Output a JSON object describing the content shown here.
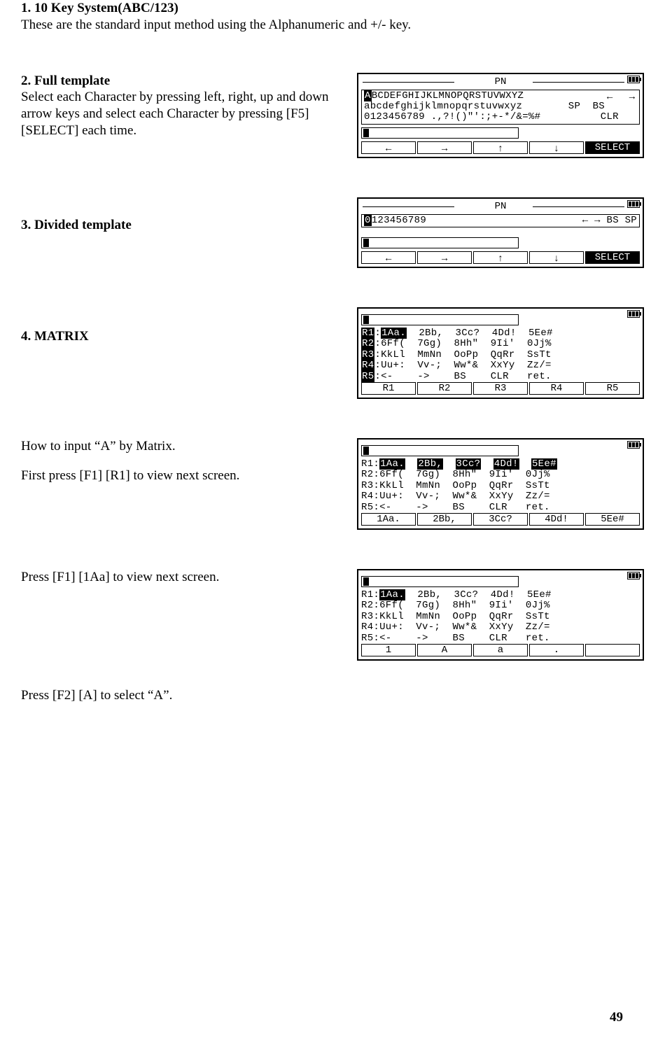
{
  "sections": {
    "s1": {
      "title": "1.  10 Key System(ABC/123)",
      "body": "These are the standard input method using the Alphanumeric and +/- key."
    },
    "s2": {
      "title": "2.  Full template",
      "body": "Select each Character by pressing left, right, up and down arrow keys and select each Character by pressing [F5] [SELECT] each time."
    },
    "s3": {
      "title": "3.  Divided template"
    },
    "s4": {
      "title": "4.  MATRIX"
    },
    "howto": {
      "line1": "How to input “A” by Matrix.",
      "line2": "First press [F1] [R1] to view next screen.",
      "line3": "Press [F1] [1Aa] to view next screen.",
      "line4": "Press [F2] [A] to select “A”."
    }
  },
  "pn_label": "PN",
  "char_rows": {
    "upper": "ABCDEFGHIJKLMNOPQRSTUVWXYZ",
    "lower": "abcdefghijklmnopqrstuvwxyz",
    "nums": "0123456789 .,?!()\"':;+-*/&=%#"
  },
  "right_labels": {
    "sp": "SP",
    "bs": "BS",
    "clr": "CLR",
    "select": "SELECT"
  },
  "arrows": {
    "left": "←",
    "right": "→",
    "up": "↑",
    "down": "↓"
  },
  "divided_line": "0123456789",
  "divided_right": "← → BS SP",
  "matrix": {
    "labels": [
      "R1",
      "R2",
      "R3",
      "R4",
      "R5"
    ],
    "rows": [
      [
        "1Aa.",
        "2Bb,",
        "3Cc?",
        "4Dd!",
        "5Ee#"
      ],
      [
        "6Ff(",
        "7Gg)",
        "8Hh\"",
        "9Ii'",
        "0Jj%"
      ],
      [
        "KkLl",
        "MmNn",
        "OoPp",
        "QqRr",
        "SsTt"
      ],
      [
        "Uu+:",
        "Vv-;",
        "Ww*&",
        "XxYy",
        "Zz/="
      ],
      [
        "<-",
        "->",
        "BS",
        "CLR",
        "ret."
      ]
    ],
    "soft1": [
      "R1",
      "R2",
      "R3",
      "R4",
      "R5"
    ],
    "soft2": [
      "1Aa.",
      "2Bb,",
      "3Cc?",
      "4Dd!",
      "5Ee#"
    ],
    "soft3": [
      "1",
      "A",
      "a",
      ".",
      ""
    ]
  },
  "page_number": "49"
}
